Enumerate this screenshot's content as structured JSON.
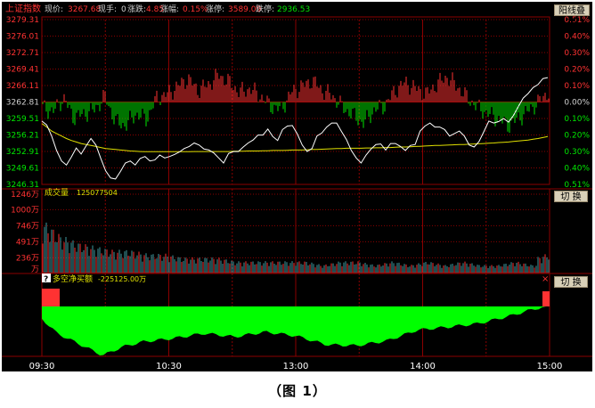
{
  "header": {
    "index_name": "上证指数",
    "price_label": "现价:",
    "price_value": "3267.68",
    "hand_label": "现手:",
    "hand_value": "0",
    "change_label": "涨跌:",
    "change_value": "4.85",
    "pct_label": "涨幅:",
    "pct_value": "0.15%",
    "up_label": "涨停:",
    "up_value": "3589.09",
    "down_label": "跌停:",
    "down_value": "2936.53",
    "stack_button": "阳线叠加"
  },
  "price_axis": {
    "left_labels": [
      "3279.31",
      "3276.01",
      "3272.71",
      "3269.41",
      "3266.11",
      "3262.81",
      "3259.51",
      "3256.21",
      "3252.91",
      "3249.61",
      "3246.31"
    ],
    "right_labels": [
      "0.51%",
      "0.40%",
      "0.30%",
      "0.20%",
      "0.10%",
      "0.00%",
      "0.10%",
      "0.20%",
      "0.30%",
      "0.40%",
      "0.51%"
    ]
  },
  "volume_panel": {
    "title": "成交量",
    "value": "125077504",
    "switch_button": "切 换",
    "left_labels": [
      "1246万",
      "1000万",
      "746万",
      "491万",
      "236万",
      "万"
    ]
  },
  "flow_panel": {
    "question": "?",
    "title": "多空净买额",
    "value": "-225125.00万",
    "switch_button": "切 换",
    "close_glyph": "×"
  },
  "time_axis": [
    "09:30",
    "10:30",
    "13:00",
    "14:00",
    "15:00"
  ],
  "caption": "（图 1）",
  "colors": {
    "up": "#ff3232",
    "down": "#00e600",
    "price_line": "#ffffff",
    "avg_line": "#e0e000",
    "grid": "#8b0000",
    "volume_bar": "#3f9aa0",
    "flow_fill": "#00ff00"
  },
  "chart_data": {
    "type": "line",
    "ylim": [
      3246.31,
      3279.31
    ],
    "base": 3262.81,
    "price": [
      3259.0,
      3258.2,
      3256.0,
      3253.1,
      3251.0,
      3250.2,
      3251.8,
      3253.6,
      3252.4,
      3254.0,
      3255.5,
      3254.2,
      3251.5,
      3249.0,
      3247.6,
      3247.4,
      3248.9,
      3250.6,
      3251.0,
      3250.2,
      3251.5,
      3251.9,
      3251.0,
      3251.2,
      3252.2,
      3251.6,
      3251.9,
      3252.3,
      3252.8,
      3253.5,
      3253.9,
      3254.6,
      3254.2,
      3253.4,
      3253.2,
      3252.6,
      3251.6,
      3250.6,
      3252.5,
      3252.9,
      3252.9,
      3253.8,
      3254.6,
      3255.2,
      3256.2,
      3256.2,
      3257.4,
      3255.9,
      3255.1,
      3257.3,
      3258.0,
      3258.1,
      3256.4,
      3254.2,
      3252.9,
      3253.5,
      3256.0,
      3256.6,
      3257.8,
      3258.6,
      3258.6,
      3256.9,
      3255.3,
      3253.1,
      3251.6,
      3250.6,
      3252.2,
      3253.4,
      3254.3,
      3254.4,
      3253.2,
      3254.5,
      3254.5,
      3253.9,
      3253.1,
      3254.1,
      3254.3,
      3257.0,
      3258.0,
      3258.6,
      3257.8,
      3257.8,
      3257.3,
      3256.0,
      3256.5,
      3257.0,
      3256.0,
      3254.2,
      3253.8,
      3254.9,
      3256.9,
      3259.0,
      3258.6,
      3258.9,
      3259.5,
      3258.8,
      3260.1,
      3261.9,
      3263.6,
      3264.5,
      3265.7,
      3266.3,
      3267.5,
      3267.7
    ],
    "avg": [
      3258.5,
      3257.8,
      3257.0,
      3256.5,
      3256.0,
      3255.5,
      3255.1,
      3254.8,
      3254.5,
      3254.3,
      3254.1,
      3253.9,
      3253.7,
      3253.5,
      3253.4,
      3253.3,
      3253.2,
      3253.1,
      3253.0,
      3252.95,
      3252.9,
      3252.85,
      3252.85,
      3252.85,
      3252.85,
      3252.85,
      3252.85,
      3252.85,
      3252.85,
      3252.85,
      3252.85,
      3252.9,
      3252.9,
      3252.9,
      3252.9,
      3252.9,
      3252.9,
      3252.9,
      3252.9,
      3252.95,
      3252.95,
      3252.95,
      3253.0,
      3253.0,
      3253.0,
      3253.05,
      3253.05,
      3253.1,
      3253.1,
      3253.1,
      3253.15,
      3253.2,
      3253.2,
      3253.2,
      3253.25,
      3253.3,
      3253.3,
      3253.35,
      3253.4,
      3253.45,
      3253.5,
      3253.5,
      3253.55,
      3253.55,
      3253.55,
      3253.55,
      3253.6,
      3253.6,
      3253.65,
      3253.65,
      3253.7,
      3253.7,
      3253.75,
      3253.8,
      3253.8,
      3253.85,
      3253.9,
      3253.95,
      3254.0,
      3254.05,
      3254.1,
      3254.1,
      3254.15,
      3254.2,
      3254.25,
      3254.3,
      3254.3,
      3254.35,
      3254.4,
      3254.45,
      3254.5,
      3254.55,
      3254.6,
      3254.7,
      3254.75,
      3254.8,
      3254.9,
      3255.0,
      3255.1,
      3255.2,
      3255.35,
      3255.5,
      3255.7,
      3255.9
    ],
    "momentum_pattern": [
      -3,
      -5,
      2,
      -8,
      -6,
      -4,
      3,
      -10,
      -12,
      -6,
      -9,
      2,
      4,
      8,
      12,
      6,
      9,
      14,
      10,
      5,
      7,
      3,
      -2,
      -4,
      5,
      8,
      11,
      6,
      3,
      -3,
      -7,
      -11,
      -4,
      -2,
      6,
      10,
      7,
      4,
      9,
      13,
      8,
      2,
      -3,
      -6,
      -9,
      -12,
      -8,
      -4,
      1,
      6
    ],
    "volume_pattern": [
      14,
      10,
      8,
      7,
      6,
      6,
      5,
      5,
      4,
      4,
      4,
      3,
      3,
      3,
      3,
      3,
      2,
      3,
      3,
      2,
      3,
      2,
      3,
      2,
      3,
      2,
      2,
      3,
      2,
      3
    ],
    "volume_ylim": [
      0,
      1246
    ],
    "flow_profile": [
      [
        0,
        0.25
      ],
      [
        0.03,
        0.55
      ],
      [
        0.08,
        0.8
      ],
      [
        0.12,
        1.0
      ],
      [
        0.16,
        0.82
      ],
      [
        0.2,
        0.72
      ],
      [
        0.26,
        0.65
      ],
      [
        0.32,
        0.55
      ],
      [
        0.38,
        0.62
      ],
      [
        0.44,
        0.52
      ],
      [
        0.5,
        0.6
      ],
      [
        0.56,
        0.78
      ],
      [
        0.62,
        0.8
      ],
      [
        0.68,
        0.7
      ],
      [
        0.74,
        0.48
      ],
      [
        0.8,
        0.42
      ],
      [
        0.86,
        0.35
      ],
      [
        0.92,
        0.2
      ],
      [
        0.97,
        0.05
      ],
      [
        1,
        0.0
      ]
    ],
    "time_labels": [
      "09:30",
      "10:30",
      "13:00",
      "14:00",
      "15:00"
    ]
  }
}
